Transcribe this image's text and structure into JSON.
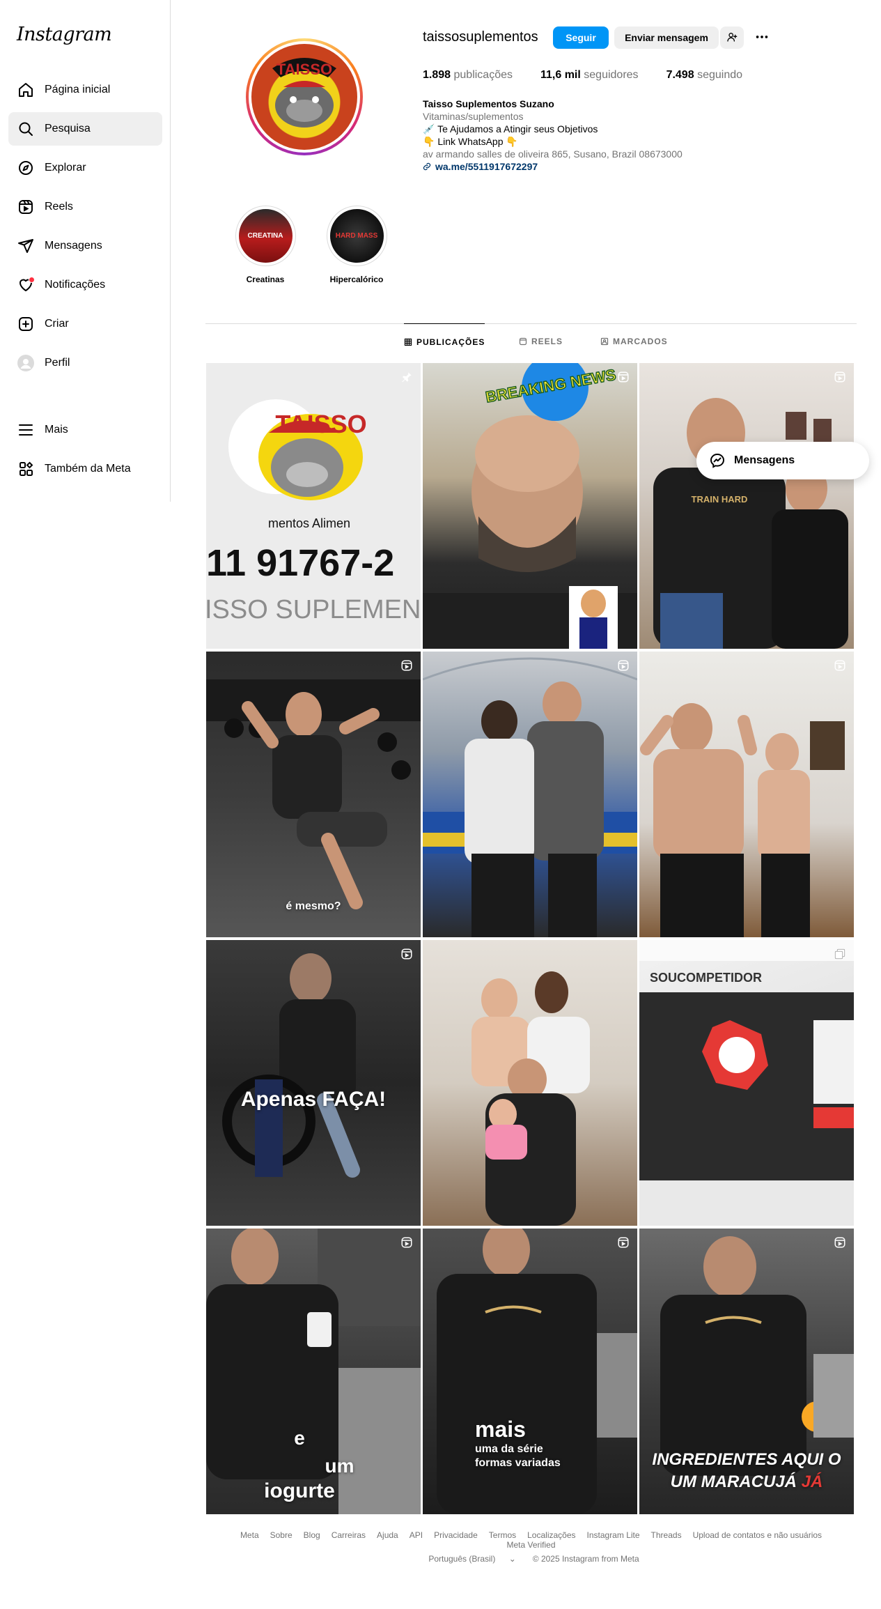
{
  "app": {
    "logo_text": "Instagram"
  },
  "sidebar": {
    "items": [
      {
        "label": "Página inicial",
        "icon": "home-icon"
      },
      {
        "label": "Pesquisa",
        "icon": "search-icon",
        "active": true
      },
      {
        "label": "Explorar",
        "icon": "compass-icon"
      },
      {
        "label": "Reels",
        "icon": "reels-icon"
      },
      {
        "label": "Mensagens",
        "icon": "send-icon"
      },
      {
        "label": "Notificações",
        "icon": "heart-icon",
        "badge": true
      },
      {
        "label": "Criar",
        "icon": "plus-square-icon"
      },
      {
        "label": "Perfil",
        "icon": "avatar"
      },
      {
        "label": "Mais",
        "icon": "menu-icon"
      },
      {
        "label": "Também da Meta",
        "icon": "meta-apps-icon"
      }
    ]
  },
  "profile": {
    "username": "taissosuplementos",
    "follow_label": "Seguir",
    "message_label": "Enviar mensagem",
    "stats": {
      "posts_value": "1.898",
      "posts_label": "publicações",
      "followers_value": "11,6 mil",
      "followers_label": "seguidores",
      "following_value": "7.498",
      "following_label": "seguindo"
    },
    "bio": {
      "name": "Taisso Suplementos Suzano",
      "category": "Vitaminas/suplementos",
      "line1": "💉 Te Ajudamos a Atingir seus Objetivos",
      "line2": "👇 Link WhatsApp 👇",
      "address": "av armando salles de oliveira 865, Susano, Brazil 08673000",
      "link": "wa.me/5511917672297"
    },
    "avatar_text": "TAISSO"
  },
  "highlights": [
    {
      "label": "Creatinas",
      "image_text": "CREATINA"
    },
    {
      "label": "Hipercalórico",
      "image_text": "HARD MASS"
    }
  ],
  "tabs": [
    {
      "label": "PUBLICAÇÕES",
      "icon": "grid-icon",
      "active": true
    },
    {
      "label": "REELS",
      "icon": "reels-icon"
    },
    {
      "label": "MARCADOS",
      "icon": "tagged-icon"
    }
  ],
  "posts": [
    {
      "type": "pinned",
      "lines": [
        "TAISSO",
        "mentos Alimen",
        "11 91767-2",
        "ISSO SUPLEMENT"
      ]
    },
    {
      "type": "reel",
      "badge": "BREAKING NEWS"
    },
    {
      "type": "reel",
      "shirt": "TRAIN HARD"
    },
    {
      "type": "reel",
      "caption": "é mesmo?"
    },
    {
      "type": "reel"
    },
    {
      "type": "reel"
    },
    {
      "type": "reel",
      "caption": "Apenas FAÇA!"
    },
    {
      "type": "none"
    },
    {
      "type": "carousel",
      "title": "SOUCOMPETIDOR"
    },
    {
      "type": "reel",
      "caption_lines": [
        "e",
        "um",
        "iogurte"
      ]
    },
    {
      "type": "reel",
      "caption_big": "mais",
      "caption_sub1": "uma da série",
      "caption_sub2": "formas variadas"
    },
    {
      "type": "reel",
      "caption_line1": "INGREDIENTES AQUI O",
      "caption_line2a": "UM MARACUJÁ ",
      "caption_line2b": "JÁ"
    }
  ],
  "floating_messages": {
    "label": "Mensagens"
  },
  "footer": {
    "links": [
      "Meta",
      "Sobre",
      "Blog",
      "Carreiras",
      "Ajuda",
      "API",
      "Privacidade",
      "Termos",
      "Localizações",
      "Instagram Lite",
      "Threads",
      "Upload de contatos e não usuários",
      "Meta Verified"
    ],
    "language": "Português (Brasil)",
    "copyright": "© 2025 Instagram from Meta"
  },
  "colors": {
    "primary": "#0095f6",
    "link": "#00376b",
    "muted": "#737373",
    "notif": "#ff3040"
  }
}
